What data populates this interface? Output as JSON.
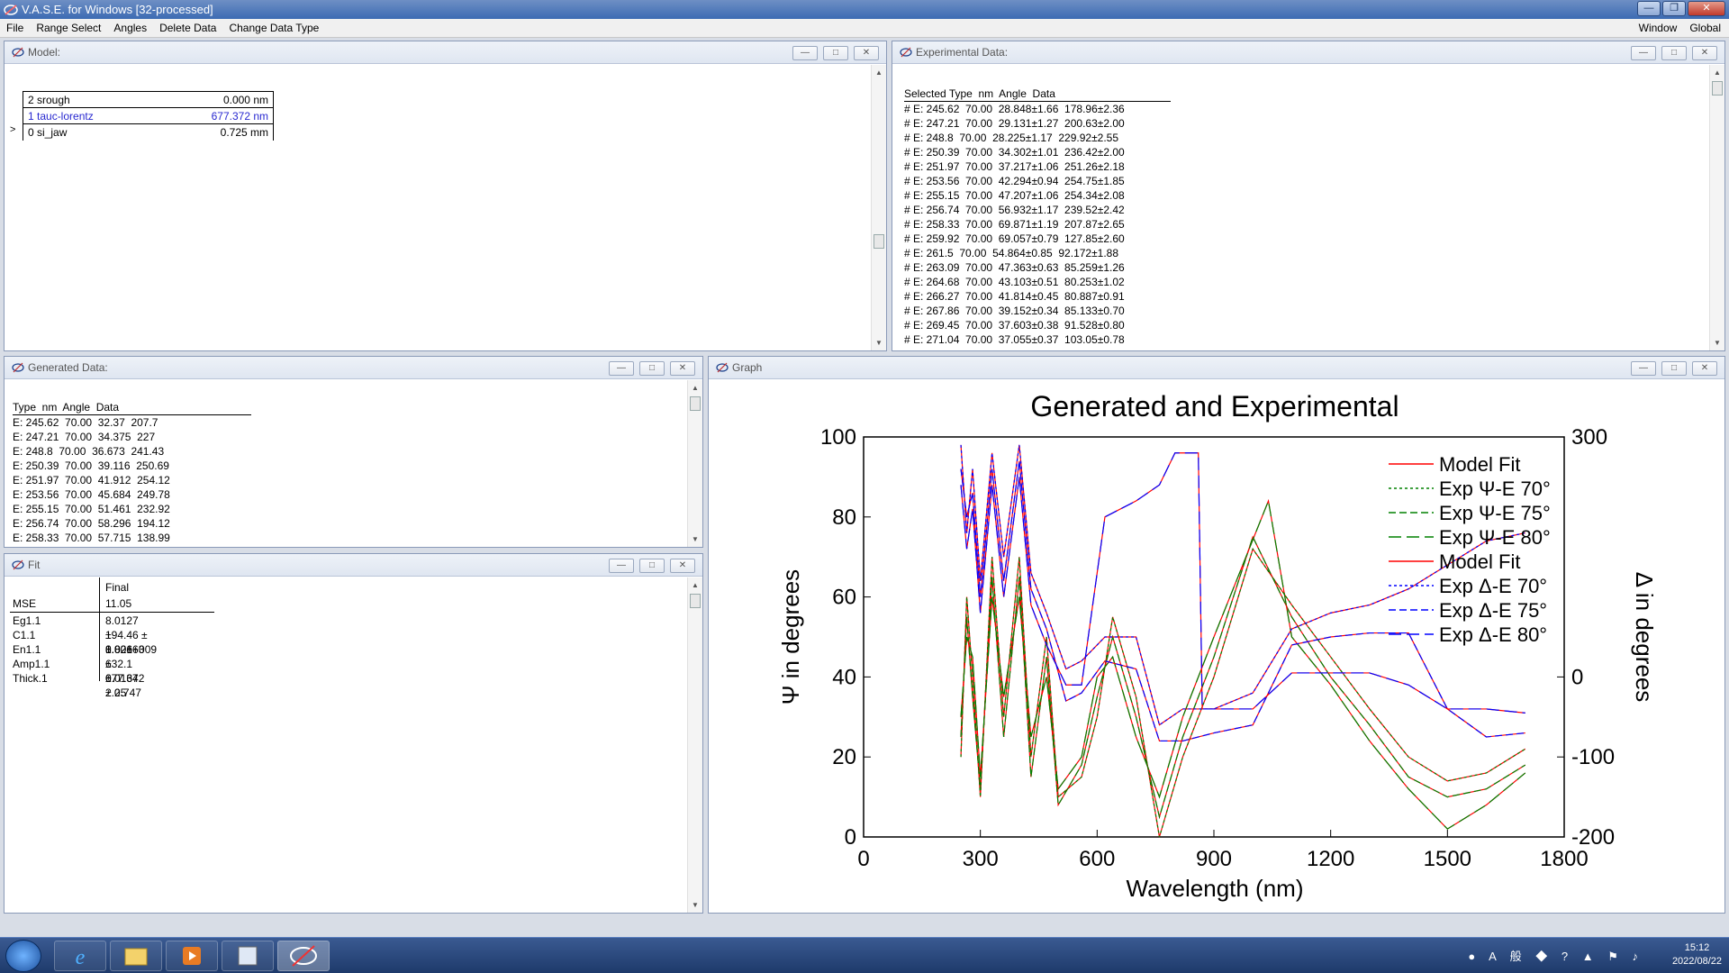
{
  "app": {
    "title": "V.A.S.E. for Windows [32-processed]"
  },
  "menu": {
    "items": [
      "File",
      "Range Select",
      "Angles",
      "Delete Data",
      "Change Data Type"
    ],
    "right_items": [
      "Window",
      "Global"
    ]
  },
  "model_window": {
    "title": "Model:",
    "layers": [
      {
        "name": "2 srough",
        "value": "0.000 nm"
      },
      {
        "name": "1 tauc-lorentz",
        "value": "677.372 nm"
      },
      {
        "name": "0 si_jaw",
        "value": "0.725 mm"
      }
    ],
    "pointer": ">"
  },
  "experimental_window": {
    "title": "Experimental Data:",
    "header": "Selected Type  nm  Angle  Data",
    "rows": [
      "# E: 245.62  70.00  28.848±1.66  178.96±2.36",
      "# E: 247.21  70.00  29.131±1.27  200.63±2.00",
      "# E: 248.8  70.00  28.225±1.17  229.92±2.55",
      "# E: 250.39  70.00  34.302±1.01  236.42±2.00",
      "# E: 251.97  70.00  37.217±1.06  251.26±2.18",
      "# E: 253.56  70.00  42.294±0.94  254.75±1.85",
      "# E: 255.15  70.00  47.207±1.06  254.34±2.08",
      "# E: 256.74  70.00  56.932±1.17  239.52±2.42",
      "# E: 258.33  70.00  69.871±1.19  207.87±2.65",
      "# E: 259.92  70.00  69.057±0.79  127.85±2.60",
      "# E: 261.5  70.00  54.864±0.85  92.172±1.88",
      "# E: 263.09  70.00  47.363±0.63  85.259±1.26",
      "# E: 264.68  70.00  43.103±0.51  80.253±1.02",
      "# E: 266.27  70.00  41.814±0.45  80.887±0.91",
      "# E: 267.86  70.00  39.152±0.34  85.133±0.70",
      "# E: 269.45  70.00  37.603±0.38  91.528±0.80",
      "# E: 271.04  70.00  37.055±0.37  103.05±0.78"
    ]
  },
  "generated_window": {
    "title": "Generated Data:",
    "header": "Type  nm  Angle  Data",
    "rows": [
      "E: 245.62  70.00  32.37  207.7",
      "E: 247.21  70.00  34.375  227",
      "E: 248.8  70.00  36.673  241.43",
      "E: 250.39  70.00  39.116  250.69",
      "E: 251.97  70.00  41.912  254.12",
      "E: 253.56  70.00  45.684  249.78",
      "E: 255.15  70.00  51.461  232.92",
      "E: 256.74  70.00  58.296  194.12",
      "E: 258.33  70.00  57.715  138.99"
    ]
  },
  "fit_window": {
    "title": "Fit",
    "column_header": "Final",
    "mse_label": "MSE",
    "mse_value": "11.05",
    "params": [
      {
        "name": "Eg1.1",
        "value": "8.0127 ± 0.00163"
      },
      {
        "name": "C1.1",
        "value": "194.46 ± 1.82e+009"
      },
      {
        "name": "En1.1",
        "value": "8.026 ± 0.0164"
      },
      {
        "name": "Amp1.1",
        "value": "632.1 ± 2.25"
      },
      {
        "name": "Thick.1",
        "value": "677.372 ± 0.747"
      }
    ]
  },
  "graph_window": {
    "title": "Graph"
  },
  "chart_data": {
    "type": "line",
    "title": "Generated and Experimental",
    "xlabel": "Wavelength (nm)",
    "ylabel": "Ψ in degrees",
    "y2label": "Δ in degrees",
    "xlim": [
      0,
      1800
    ],
    "ylim": [
      0,
      100
    ],
    "y2lim": [
      -200,
      300
    ],
    "x_ticks": [
      "0",
      "300",
      "600",
      "900",
      "1200",
      "1500",
      "1800"
    ],
    "y_ticks": [
      "0",
      "20",
      "40",
      "60",
      "80",
      "100"
    ],
    "y2_ticks": [
      "-200",
      "-100",
      "0",
      "300"
    ],
    "legend": [
      {
        "name": "Model Fit",
        "color": "#ff0000",
        "dash": "solid"
      },
      {
        "name": "Exp Ψ-E 70°",
        "color": "#008000",
        "dash": "dot"
      },
      {
        "name": "Exp Ψ-E 75°",
        "color": "#008000",
        "dash": "dash"
      },
      {
        "name": "Exp Ψ-E 80°",
        "color": "#008000",
        "dash": "longdash"
      },
      {
        "name": "Model Fit",
        "color": "#ff0000",
        "dash": "solid"
      },
      {
        "name": "Exp Δ-E 70°",
        "color": "#0000ff",
        "dash": "dot"
      },
      {
        "name": "Exp Δ-E 75°",
        "color": "#0000ff",
        "dash": "dash"
      },
      {
        "name": "Exp Δ-E 80°",
        "color": "#0000ff",
        "dash": "longdash"
      }
    ],
    "legend_position": "top-right",
    "series": [
      {
        "axis": "psi",
        "color": "#008000",
        "values": [
          [
            250,
            20
          ],
          [
            265,
            60
          ],
          [
            280,
            40
          ],
          [
            300,
            10
          ],
          [
            330,
            70
          ],
          [
            360,
            30
          ],
          [
            400,
            70
          ],
          [
            430,
            20
          ],
          [
            470,
            50
          ],
          [
            500,
            10
          ],
          [
            560,
            15
          ],
          [
            600,
            30
          ],
          [
            640,
            55
          ],
          [
            700,
            35
          ],
          [
            760,
            0
          ],
          [
            820,
            20
          ],
          [
            900,
            40
          ],
          [
            1000,
            72
          ],
          [
            1100,
            58
          ],
          [
            1200,
            45
          ],
          [
            1300,
            32
          ],
          [
            1400,
            20
          ],
          [
            1500,
            14
          ],
          [
            1600,
            16
          ],
          [
            1700,
            22
          ]
        ]
      },
      {
        "axis": "psi",
        "color": "#008000",
        "values": [
          [
            250,
            25
          ],
          [
            265,
            55
          ],
          [
            280,
            35
          ],
          [
            300,
            12
          ],
          [
            330,
            65
          ],
          [
            360,
            25
          ],
          [
            400,
            65
          ],
          [
            430,
            15
          ],
          [
            470,
            45
          ],
          [
            500,
            8
          ],
          [
            560,
            18
          ],
          [
            600,
            35
          ],
          [
            640,
            50
          ],
          [
            700,
            30
          ],
          [
            760,
            5
          ],
          [
            820,
            25
          ],
          [
            900,
            45
          ],
          [
            1000,
            75
          ],
          [
            1100,
            55
          ],
          [
            1200,
            40
          ],
          [
            1300,
            28
          ],
          [
            1400,
            15
          ],
          [
            1500,
            10
          ],
          [
            1600,
            12
          ],
          [
            1700,
            18
          ]
        ]
      },
      {
        "axis": "psi",
        "color": "#008000",
        "values": [
          [
            250,
            30
          ],
          [
            265,
            50
          ],
          [
            280,
            45
          ],
          [
            300,
            15
          ],
          [
            330,
            60
          ],
          [
            360,
            35
          ],
          [
            400,
            60
          ],
          [
            430,
            25
          ],
          [
            470,
            40
          ],
          [
            500,
            12
          ],
          [
            560,
            20
          ],
          [
            600,
            40
          ],
          [
            640,
            45
          ],
          [
            700,
            25
          ],
          [
            760,
            10
          ],
          [
            820,
            30
          ],
          [
            900,
            50
          ],
          [
            1040,
            84
          ],
          [
            1100,
            50
          ],
          [
            1200,
            38
          ],
          [
            1300,
            24
          ],
          [
            1400,
            12
          ],
          [
            1500,
            2
          ],
          [
            1600,
            8
          ],
          [
            1700,
            16
          ]
        ]
      },
      {
        "axis": "delta",
        "color": "#0000ff",
        "values": [
          [
            250,
            290
          ],
          [
            265,
            180
          ],
          [
            280,
            260
          ],
          [
            300,
            120
          ],
          [
            330,
            280
          ],
          [
            360,
            150
          ],
          [
            400,
            290
          ],
          [
            430,
            130
          ],
          [
            470,
            80
          ],
          [
            520,
            10
          ],
          [
            560,
            20
          ],
          [
            620,
            50
          ],
          [
            700,
            50
          ],
          [
            760,
            -60
          ],
          [
            820,
            -40
          ],
          [
            900,
            -40
          ],
          [
            1000,
            -20
          ],
          [
            1100,
            60
          ],
          [
            1200,
            80
          ],
          [
            1300,
            90
          ],
          [
            1400,
            110
          ],
          [
            1500,
            140
          ],
          [
            1600,
            170
          ],
          [
            1700,
            180
          ]
        ]
      },
      {
        "axis": "delta",
        "color": "#0000ff",
        "values": [
          [
            250,
            260
          ],
          [
            265,
            200
          ],
          [
            280,
            230
          ],
          [
            300,
            100
          ],
          [
            330,
            260
          ],
          [
            360,
            120
          ],
          [
            400,
            270
          ],
          [
            430,
            110
          ],
          [
            470,
            60
          ],
          [
            520,
            -30
          ],
          [
            560,
            -20
          ],
          [
            620,
            20
          ],
          [
            700,
            10
          ],
          [
            760,
            -80
          ],
          [
            820,
            -80
          ],
          [
            900,
            -70
          ],
          [
            1000,
            -60
          ],
          [
            1100,
            40
          ],
          [
            1200,
            50
          ],
          [
            1300,
            55
          ],
          [
            1400,
            55
          ],
          [
            1500,
            -40
          ],
          [
            1600,
            -75
          ],
          [
            1700,
            -70
          ]
        ]
      },
      {
        "axis": "delta",
        "color": "#0000ff",
        "values": [
          [
            250,
            240
          ],
          [
            265,
            160
          ],
          [
            280,
            210
          ],
          [
            300,
            80
          ],
          [
            330,
            240
          ],
          [
            360,
            100
          ],
          [
            400,
            250
          ],
          [
            430,
            90
          ],
          [
            470,
            40
          ],
          [
            520,
            -10
          ],
          [
            560,
            -10
          ],
          [
            620,
            200
          ],
          [
            700,
            220
          ],
          [
            760,
            240
          ],
          [
            800,
            280
          ],
          [
            860,
            280
          ],
          [
            870,
            -40
          ],
          [
            1000,
            -40
          ],
          [
            1100,
            5
          ],
          [
            1200,
            5
          ],
          [
            1300,
            5
          ],
          [
            1400,
            -10
          ],
          [
            1500,
            -40
          ],
          [
            1600,
            -40
          ],
          [
            1700,
            -45
          ]
        ]
      }
    ]
  }
}
